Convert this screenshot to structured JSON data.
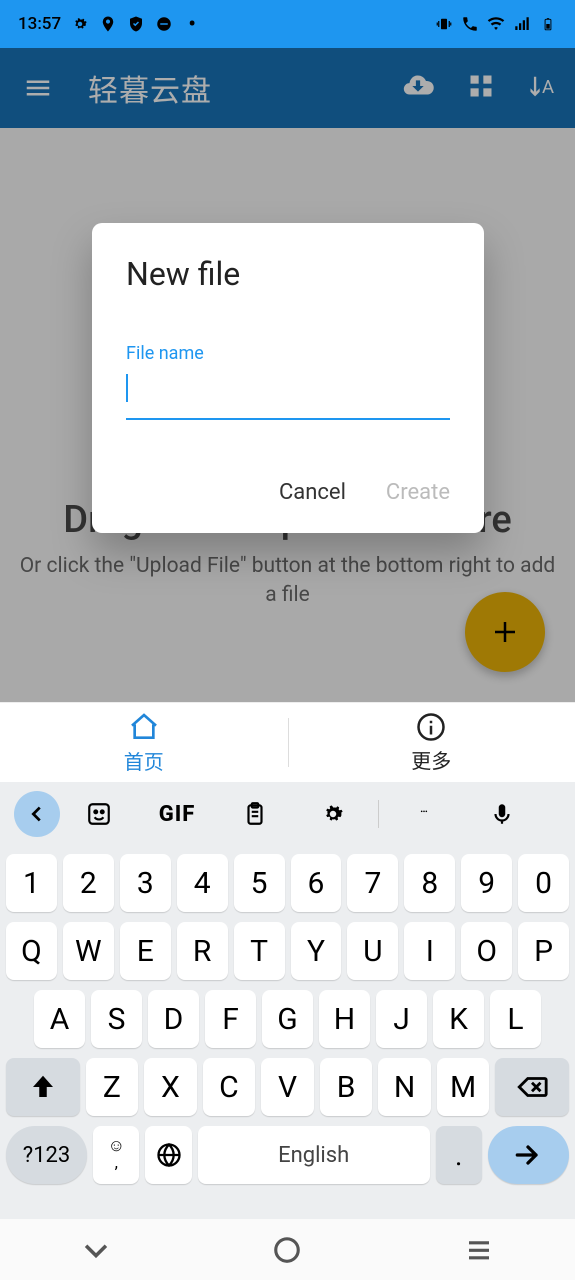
{
  "status": {
    "time": "13:57"
  },
  "appbar": {
    "title": "轻暮云盘"
  },
  "main": {
    "big_hint": "Drag and drop the file here",
    "small_hint": "Or click the \"Upload File\" button at the bottom right to add a file"
  },
  "dialog": {
    "title": "New file",
    "field_label": "File name",
    "value": "",
    "cancel": "Cancel",
    "create": "Create"
  },
  "tabs": {
    "home": "首页",
    "more": "更多"
  },
  "keyboard": {
    "gif": "GIF",
    "rows": {
      "nums": [
        "1",
        "2",
        "3",
        "4",
        "5",
        "6",
        "7",
        "8",
        "9",
        "0"
      ],
      "r1": [
        "Q",
        "W",
        "E",
        "R",
        "T",
        "Y",
        "U",
        "I",
        "O",
        "P"
      ],
      "r2": [
        "A",
        "S",
        "D",
        "F",
        "G",
        "H",
        "J",
        "K",
        "L"
      ],
      "r3": [
        "Z",
        "X",
        "C",
        "V",
        "B",
        "N",
        "M"
      ]
    },
    "q123": "?123",
    "emoji_sub": ",",
    "space": "English",
    "period": "."
  }
}
